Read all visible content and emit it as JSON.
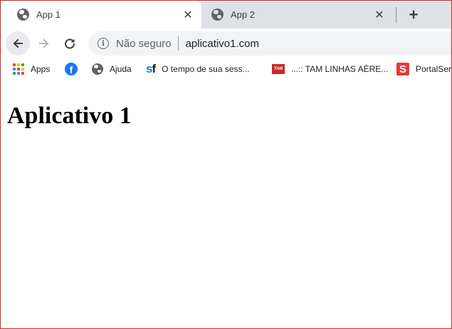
{
  "tabs": [
    {
      "title": "App 1",
      "icon": "globe-icon",
      "active": true
    },
    {
      "title": "App 2",
      "icon": "globe-icon",
      "active": false
    }
  ],
  "tab_close_glyph": "✕",
  "new_tab_glyph": "+",
  "toolbar": {
    "security_label": "Não seguro",
    "url": "aplicativo1.com",
    "info_glyph": "i"
  },
  "bookmarks": [
    {
      "label": "Apps",
      "icon": "apps-grid-icon"
    },
    {
      "label": "",
      "icon": "facebook-icon"
    },
    {
      "label": "Ajuda",
      "icon": "globe-icon"
    },
    {
      "label": "O tempo de sua sess...",
      "icon": "sf-icon"
    },
    {
      "label": "...:: TAM LINHAS AÉRE...",
      "icon": "tam-icon"
    },
    {
      "label": "PortalSer",
      "icon": "portal-s-icon"
    }
  ],
  "bookmark_icon_text": {
    "facebook": "f",
    "sf_s": "s",
    "sf_f": "f",
    "tam": "TAM",
    "portal": "S"
  },
  "page": {
    "heading": "Aplicativo 1"
  },
  "colors": {
    "frame_border": "#d6262b",
    "tabstrip_bg": "#dee1e6",
    "omnibox_bg": "#f1f3f4",
    "apps_grid": [
      "#ea4335",
      "#fbbc05",
      "#34a853",
      "#4285f4",
      "#ea4335",
      "#fbbc05",
      "#34a853",
      "#4285f4",
      "#ea4335"
    ]
  }
}
